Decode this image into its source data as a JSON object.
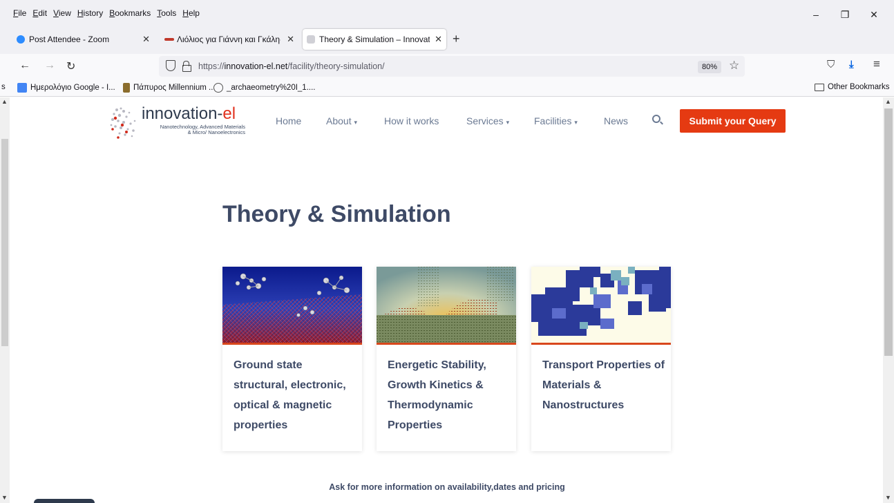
{
  "menubar": {
    "items": [
      "File",
      "Edit",
      "View",
      "History",
      "Bookmarks",
      "Tools",
      "Help"
    ]
  },
  "window_controls": {
    "minimize": "–",
    "restore": "❐",
    "close": "✕"
  },
  "tabs": [
    {
      "label": "Post Attendee - Zoom",
      "favicon_color": "#2d8cff"
    },
    {
      "label": "Λιόλιος για Γιάννη και Γκάλη-Γεωργ",
      "favicon_color": "#c0392b"
    },
    {
      "label": "Theory & Simulation – Innovation-el",
      "favicon_color": "#b0b0b8"
    }
  ],
  "tab_close": "✕",
  "new_tab": "+",
  "nav": {
    "back": "←",
    "forward": "→",
    "reload": "↻",
    "url_prefix": "https://",
    "url_host": "innovation-el.net",
    "url_path": "/facility/theory-simulation/",
    "zoom": "80%",
    "bookmark_star": "☆",
    "pocket": "⛉",
    "download": "⤓",
    "menu": "≡"
  },
  "bookmarks": {
    "items": [
      {
        "label": "Ημερολόγιο Google - I...",
        "icon_color": "#4285f4"
      },
      {
        "label": "Πάπυρος Millennium ...",
        "icon_color": "#8b6d2d"
      },
      {
        "label": "_archaeometry%20I_1....",
        "icon_color": "#555555"
      }
    ],
    "other": "Other Bookmarks",
    "left_cut": "s"
  },
  "site": {
    "brand_main": "innovation-",
    "brand_accent": "el",
    "tagline_1": "Nanotechnology, Advanced Materials",
    "tagline_2": "& Micro/ Nanoelectronics",
    "nav": [
      {
        "label": "Home",
        "caret": ""
      },
      {
        "label": "About",
        "caret": "▾"
      },
      {
        "label": "How it works",
        "caret": ""
      },
      {
        "label": "Services",
        "caret": "▾"
      },
      {
        "label": "Facilities",
        "caret": "▾"
      },
      {
        "label": "News",
        "caret": ""
      }
    ],
    "submit": "Submit your Query",
    "title": "Theory & Simulation",
    "cards": [
      {
        "text": "Ground state structural, electronic, optical & magnetic properties"
      },
      {
        "text": "Energetic Stability, Growth Kinetics & Thermodynamic Properties"
      },
      {
        "text": "Transport Properties of Materials & Nanostructures"
      }
    ],
    "ask": "Ask for more information on availability,dates and pricing"
  },
  "colors": {
    "accent": "#e53a12",
    "heading": "#3e4a66",
    "nav": "#6b7a93"
  }
}
